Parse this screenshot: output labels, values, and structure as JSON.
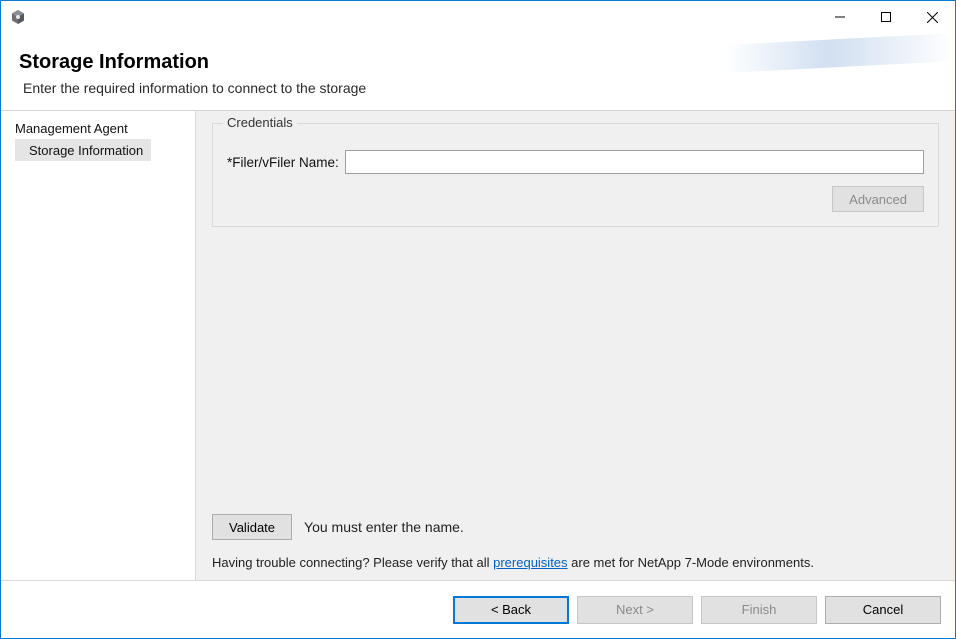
{
  "window": {
    "title": ""
  },
  "header": {
    "title": "Storage Information",
    "subtitle": "Enter the required information to connect to the storage"
  },
  "sidebar": {
    "items": [
      {
        "label": "Management Agent",
        "selected": false
      },
      {
        "label": "Storage Information",
        "selected": true
      }
    ]
  },
  "content": {
    "groupbox_legend": "Credentials",
    "filer_label": "*Filer/vFiler Name:",
    "filer_value": "",
    "advanced_label": "Advanced",
    "validate_label": "Validate",
    "validation_message": "You must enter the name.",
    "help_prefix": "Having trouble connecting? Please verify that all ",
    "help_link": "prerequisites",
    "help_suffix": " are met for NetApp 7-Mode environments."
  },
  "footer": {
    "back": "< Back",
    "next": "Next >",
    "finish": "Finish",
    "cancel": "Cancel"
  }
}
